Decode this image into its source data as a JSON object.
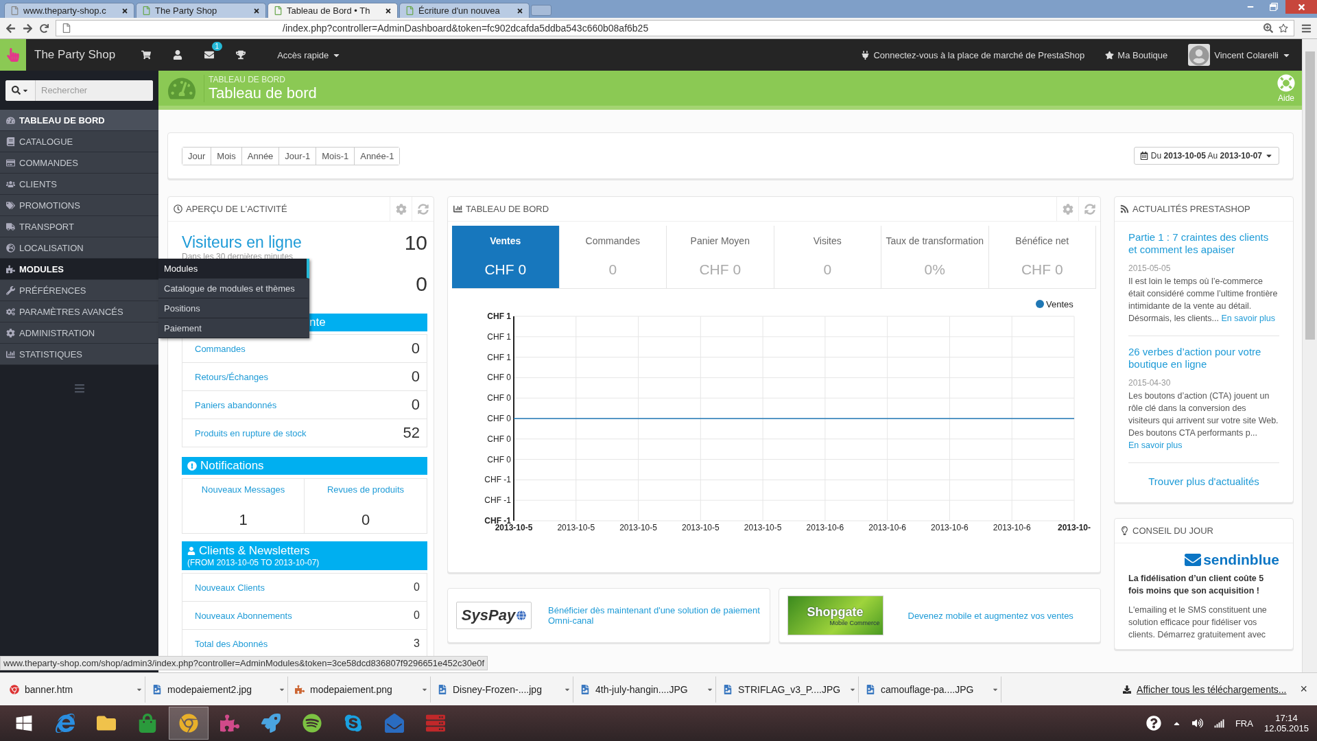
{
  "browser": {
    "tabs": [
      {
        "title": "www.theparty-shop.c",
        "selected": false
      },
      {
        "title": "The Party Shop",
        "selected": false
      },
      {
        "title": "Tableau de Bord • Th",
        "selected": true
      },
      {
        "title": "Écriture d'un nouvea",
        "selected": false
      }
    ],
    "address": "/index.php?controller=AdminDashboard&token=fc902dcafda5ddba543c660b08af6b25"
  },
  "topbar": {
    "shop_name": "The Party Shop",
    "message_count": "1",
    "quick_access": "Accès rapide",
    "marketplace": "Connectez-vous à la place de marché de PrestaShop",
    "my_shop": "Ma Boutique",
    "user": "Vincent Colarelli"
  },
  "header": {
    "breadcrumb": "TABLEAU DE BORD",
    "title": "Tableau de bord",
    "help": "Aide"
  },
  "sidebar": {
    "search_placeholder": "Rechercher",
    "items": [
      {
        "label": "TABLEAU DE BORD",
        "selected": true,
        "expanded": false
      },
      {
        "label": "CATALOGUE",
        "selected": false,
        "expanded": false
      },
      {
        "label": "COMMANDES",
        "selected": false,
        "expanded": false
      },
      {
        "label": "CLIENTS",
        "selected": false,
        "expanded": false
      },
      {
        "label": "PROMOTIONS",
        "selected": false,
        "expanded": false
      },
      {
        "label": "TRANSPORT",
        "selected": false,
        "expanded": false
      },
      {
        "label": "LOCALISATION",
        "selected": false,
        "expanded": false
      },
      {
        "label": "MODULES",
        "selected": false,
        "expanded": true,
        "submenu": [
          {
            "label": "Modules",
            "selected": true
          },
          {
            "label": "Catalogue de modules et thèmes",
            "selected": false
          },
          {
            "label": "Positions",
            "selected": false
          },
          {
            "label": "Paiement",
            "selected": false
          }
        ]
      },
      {
        "label": "PRÉFÉRENCES",
        "selected": false,
        "expanded": false
      },
      {
        "label": "PARAMÈTRES AVANCÉS",
        "selected": false,
        "expanded": false
      },
      {
        "label": "ADMINISTRATION",
        "selected": false,
        "expanded": false
      },
      {
        "label": "STATISTIQUES",
        "selected": false,
        "expanded": false
      }
    ]
  },
  "date_filter": {
    "periods": [
      "Jour",
      "Mois",
      "Année",
      "Jour-1",
      "Mois-1",
      "Année-1"
    ],
    "range": "Du **2013-10-05** Au **2013-10-07**"
  },
  "activity": {
    "title": "APERÇU DE L'ACTIVITÉ",
    "online_label": "Visiteurs en ligne",
    "online_sub": "Dans les 30 dernières minutes",
    "online_value": "10",
    "second_value": "0",
    "pending_bar": "nte",
    "pending_rows": [
      {
        "label": "Commandes",
        "value": "0"
      },
      {
        "label": "Retours/Échanges",
        "value": "0"
      },
      {
        "label": "Paniers abandonnés",
        "value": "0"
      },
      {
        "label": "Produits en rupture de stock",
        "value": "52"
      }
    ],
    "notifications": {
      "title": "Notifications",
      "columns": [
        {
          "label": "Nouveaux Messages",
          "value": "1"
        },
        {
          "label": "Revues de produits",
          "value": "0"
        }
      ]
    },
    "clients": {
      "title": "Clients & Newsletters",
      "subtitle": "(FROM 2013-10-05 TO 2013-10-07)",
      "rows": [
        {
          "label": "Nouveaux Clients",
          "value": "0"
        },
        {
          "label": "Nouveaux Abonnements",
          "value": "0"
        },
        {
          "label": "Total des Abonnés",
          "value": "3"
        }
      ]
    }
  },
  "dashboard": {
    "title": "TABLEAU DE BORD",
    "kpis": [
      {
        "label": "Ventes",
        "value": "CHF 0",
        "selected": true
      },
      {
        "label": "Commandes",
        "value": "0",
        "selected": false
      },
      {
        "label": "Panier Moyen",
        "value": "CHF 0",
        "selected": false
      },
      {
        "label": "Visites",
        "value": "0",
        "selected": false
      },
      {
        "label": "Taux de transformation",
        "value": "0%",
        "selected": false
      },
      {
        "label": "Bénéfice net",
        "value": "CHF 0",
        "selected": false
      }
    ],
    "chart_data": {
      "type": "line",
      "grid": true,
      "categories": [
        "2013-10-5",
        "2013-10-5",
        "2013-10-5",
        "2013-10-5",
        "2013-10-5",
        "2013-10-6",
        "2013-10-6",
        "2013-10-6",
        "2013-10-6",
        "2013-10-"
      ],
      "ylim": [
        -1,
        1
      ],
      "yticks": [
        {
          "value": 1,
          "label": "CHF 1"
        },
        {
          "value": 0.8,
          "label": "CHF 1"
        },
        {
          "value": 0.6,
          "label": "CHF 1"
        },
        {
          "value": 0.4,
          "label": "CHF 0"
        },
        {
          "value": 0.2,
          "label": "CHF 0"
        },
        {
          "value": 0,
          "label": "CHF 0"
        },
        {
          "value": -0.2,
          "label": "CHF 0"
        },
        {
          "value": -0.4,
          "label": "CHF 0"
        },
        {
          "value": -0.6,
          "label": "CHF -1"
        },
        {
          "value": -0.8,
          "label": "CHF -1"
        },
        {
          "value": -1,
          "label": "CHF -1"
        }
      ],
      "series": [
        {
          "name": "Ventes",
          "color": "#1f77b4",
          "values": [
            0,
            0,
            0,
            0,
            0,
            0,
            0,
            0,
            0,
            0
          ]
        }
      ]
    }
  },
  "partners": [
    {
      "kind": "plain",
      "logo": "SysPay",
      "text": "Bénéficier dès maintenant d'une solution de paiement Omni-canal"
    },
    {
      "kind": "banner",
      "logo": "Shopgate",
      "logo_sub": "Mobile Commerce",
      "text": "Devenez mobile et augmentez vos ventes"
    }
  ],
  "news": {
    "title": "ACTUALITÉS PRESTASHOP",
    "articles": [
      {
        "title": "Partie 1 : 7 craintes des clients et comment les apaiser",
        "date": "2015-05-05",
        "excerpt": "Il est loin le temps où l’e-commerce était considéré comme l’ultime frontière intimidante de la vente au détail. Désormais, les clients...",
        "more": "En savoir plus"
      },
      {
        "title": "26 verbes d’action pour votre boutique en ligne",
        "date": "2015-04-30",
        "excerpt": "Les boutons d’action (CTA) jouent un rôle clé dans la conversion des visiteurs qui arrivent sur votre site Web. Des boutons CTA performants p...",
        "more": "En savoir plus"
      }
    ],
    "more_link": "Trouver plus d'actualités"
  },
  "tip": {
    "title": "CONSEIL DU JOUR",
    "logo": "sendinblue",
    "headline": "La fidélisation d’un client coûte 5 fois moins que son acquisition !",
    "body": "L'emailing et le SMS constituent une solution efficace pour fidéliser vos clients. Démarrez gratuitement avec"
  },
  "status_url": "www.theparty-shop.com/shop/admin3/index.php?controller=AdminModules&token=3ce58dcd836807f9296651e452c30e0f",
  "downloads": {
    "items": [
      {
        "kind": "page",
        "name": "banner.htm"
      },
      {
        "kind": "image",
        "name": "modepaiement2.jpg"
      },
      {
        "kind": "png",
        "name": "modepaiement.png"
      },
      {
        "kind": "image",
        "name": "Disney-Frozen-....jpg"
      },
      {
        "kind": "image",
        "name": "4th-july-hangin....JPG"
      },
      {
        "kind": "image",
        "name": "STRIFLAG_v3_P....JPG"
      },
      {
        "kind": "image",
        "name": "camouflage-pa....JPG"
      }
    ],
    "show_all": "Afficher tous les téléchargements...",
    "close": "×"
  },
  "taskbar": {
    "apps": [
      {
        "selected": false
      },
      {
        "selected": false
      },
      {
        "selected": false
      },
      {
        "selected": true
      },
      {
        "selected": false
      },
      {
        "selected": false
      },
      {
        "selected": false
      },
      {
        "selected": false
      },
      {
        "selected": false
      },
      {
        "selected": false
      }
    ],
    "language": "FRA",
    "time": "17:14",
    "date": "12.05.2015"
  }
}
